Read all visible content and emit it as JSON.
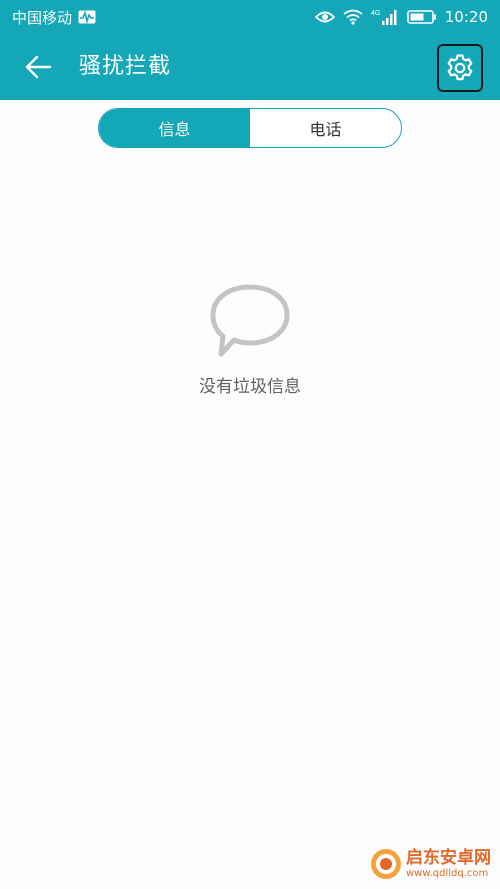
{
  "status_bar": {
    "carrier": "中国移动",
    "network_type": "4G",
    "time": "10:20",
    "icons": [
      "activity-icon",
      "eye-icon",
      "wifi-icon",
      "signal-icon",
      "battery-icon"
    ]
  },
  "app_bar": {
    "title": "骚扰拦截",
    "back_icon": "arrow-left-icon",
    "settings_icon": "gear-icon"
  },
  "tabs": [
    {
      "label": "信息",
      "active": true
    },
    {
      "label": "电话",
      "active": false
    }
  ],
  "empty_state": {
    "icon": "speech-bubble-icon",
    "message": "没有垃圾信息"
  },
  "watermark": {
    "text": "启东安卓网",
    "url": "www.qdlldq.com"
  },
  "colors": {
    "accent": "#14a7b8",
    "background": "#fdfdfd",
    "empty_text": "#606060",
    "icon_gray": "#c4c4c4"
  }
}
